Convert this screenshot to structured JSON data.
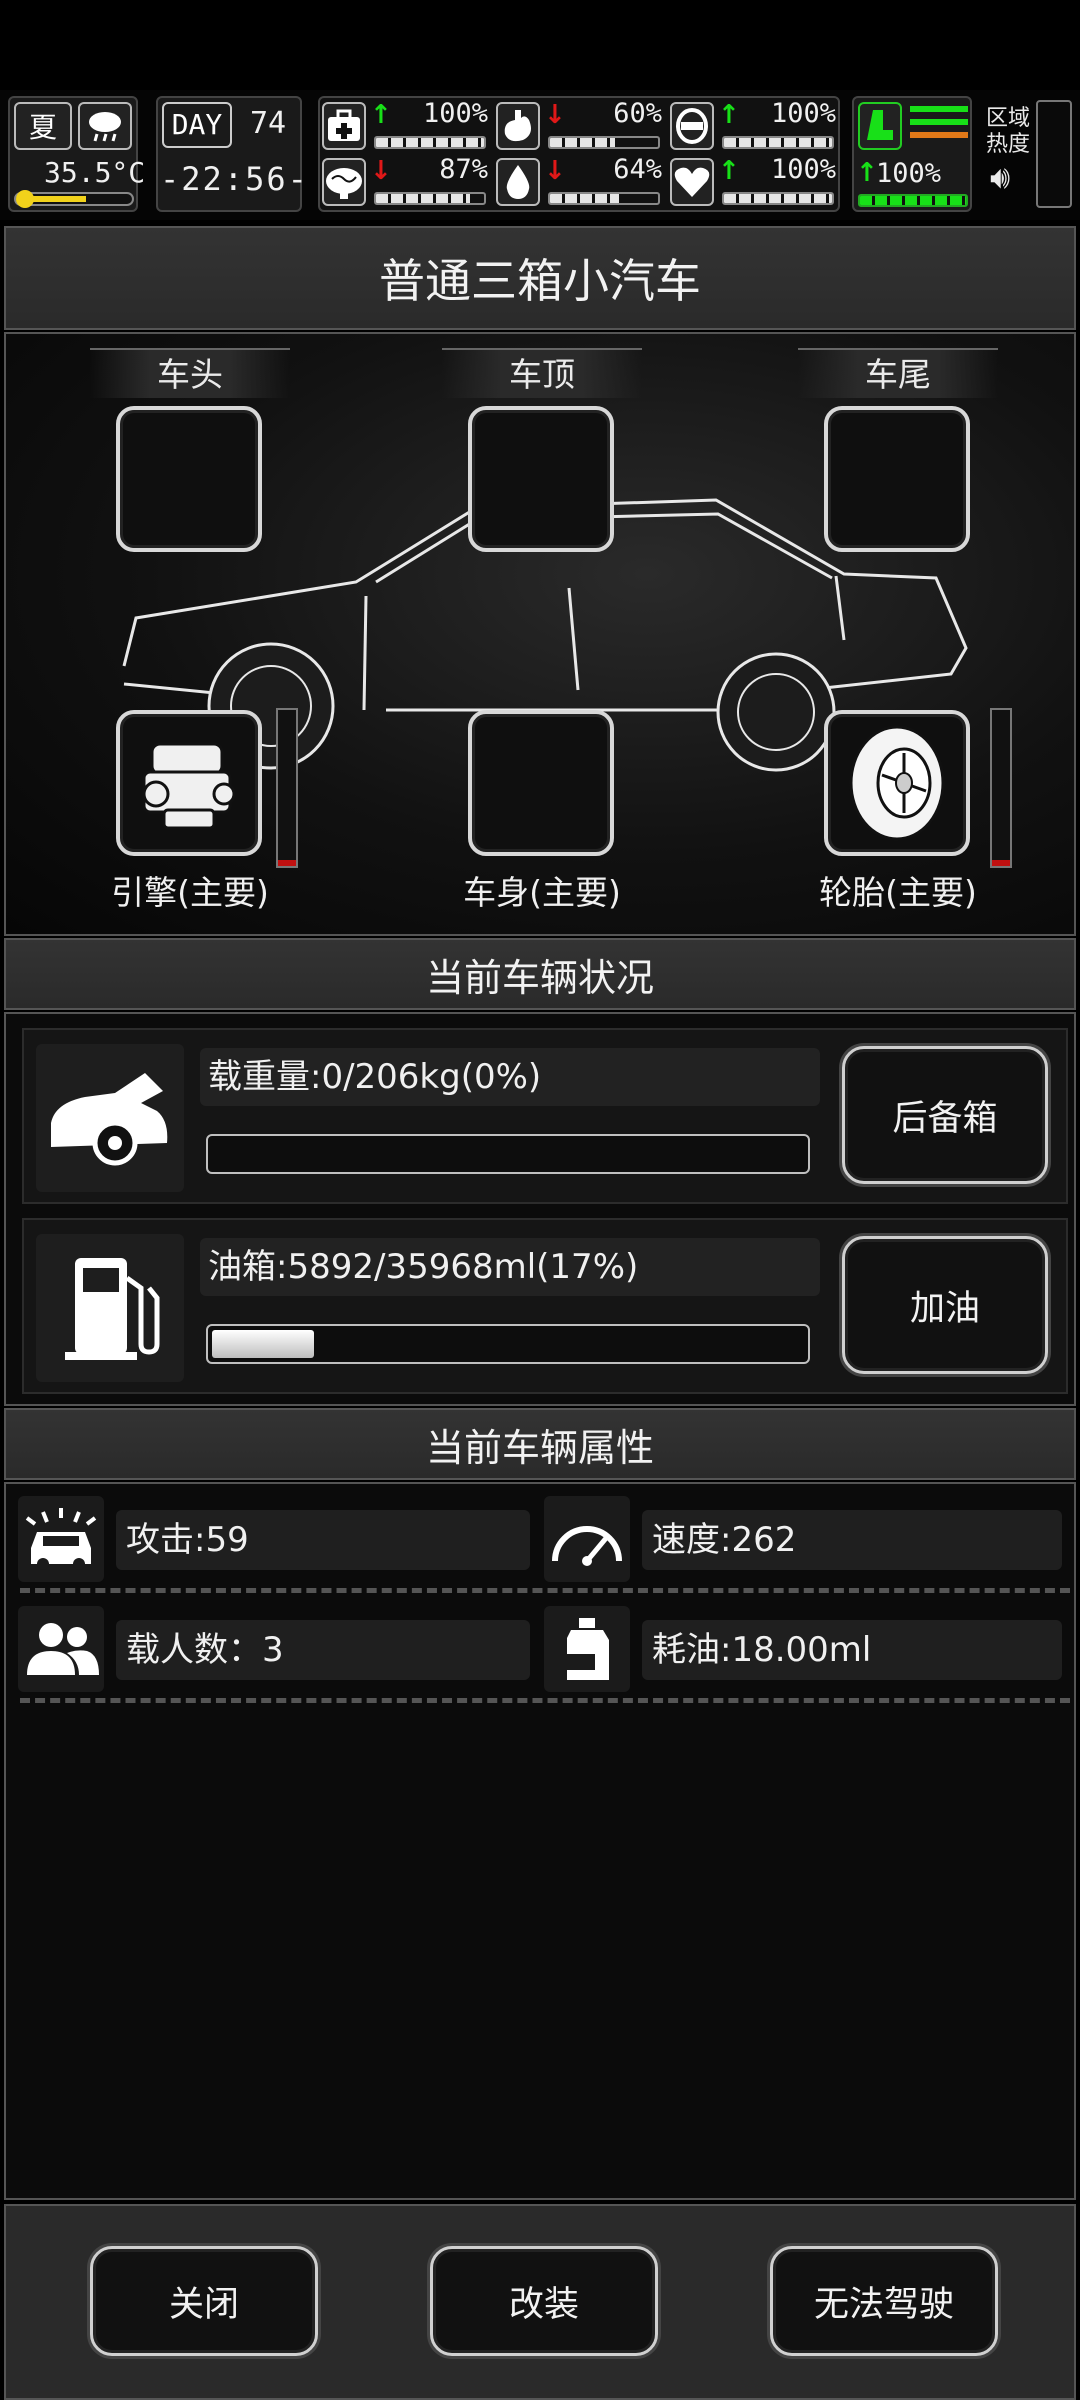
{
  "status": {
    "season": "夏",
    "temperature": "35.5°C",
    "day_label": "DAY",
    "day_number": "74",
    "clock": "-22:56-",
    "stats": [
      {
        "icon": "medkit-icon",
        "trend": "up",
        "value": "100%",
        "level": 1.0
      },
      {
        "icon": "stomach-icon",
        "trend": "down",
        "value": "60%",
        "level": 0.6
      },
      {
        "icon": "helmet-icon",
        "trend": "up",
        "value": "100%",
        "level": 1.0
      },
      {
        "icon": "brain-icon",
        "trend": "down",
        "value": "87%",
        "level": 0.87
      },
      {
        "icon": "water-drop-icon",
        "trend": "down",
        "value": "64%",
        "level": 0.64
      },
      {
        "icon": "heart-icon",
        "trend": "up",
        "value": "100%",
        "level": 1.0
      }
    ],
    "stamina_value": "100%",
    "zone_label_line1": "区域",
    "zone_label_line2": "热度"
  },
  "vehicle": {
    "name": "普通三箱小汽车",
    "slots": {
      "head": "车头",
      "roof": "车顶",
      "tail": "车尾",
      "engine": "引擎(主要)",
      "body": "车身(主要)",
      "tire": "轮胎(主要)"
    },
    "engine_gauge_level": 0.04,
    "tire_gauge_level": 0.04
  },
  "condition": {
    "title": "当前车辆状况",
    "load_text": "载重量:0/206kg(0%)",
    "load_fraction": 0.0,
    "trunk_button": "后备箱",
    "fuel_text": "油箱:5892/35968ml(17%)",
    "fuel_fraction": 0.17,
    "refuel_button": "加油"
  },
  "attributes": {
    "title": "当前车辆属性",
    "attack": "攻击:59",
    "speed": "速度:262",
    "passengers": "载人数：3",
    "fuel_use": "耗油:18.00ml"
  },
  "footer": {
    "close": "关闭",
    "modify": "改装",
    "drive": "无法驾驶"
  }
}
